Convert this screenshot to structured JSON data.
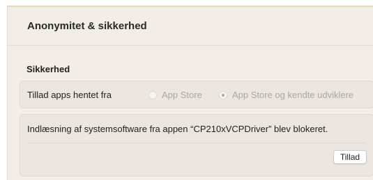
{
  "header": {
    "title": "Anonymitet & sikkerhed"
  },
  "security": {
    "section_title": "Sikkerhed",
    "allow_apps_label": "Tillad apps hentet fra",
    "options": [
      {
        "label": "App Store",
        "selected": false
      },
      {
        "label": "App Store og kendte udviklere",
        "selected": true
      }
    ],
    "blocked_message": "Indlæsning af systemsoftware fra appen “CP210xVCPDriver” blev blokeret.",
    "allow_button_label": "Tillad"
  },
  "colors": {
    "background": "#f2ede6",
    "panel": "#ebe6df",
    "disabled_text": "#a9a6a2"
  }
}
